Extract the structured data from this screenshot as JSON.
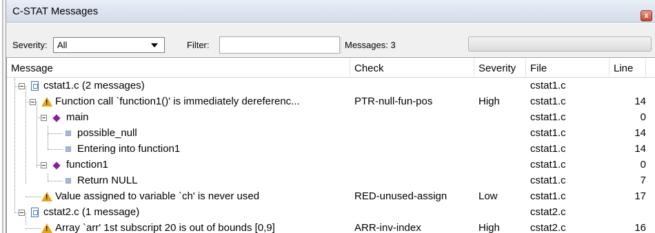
{
  "window": {
    "title": "C-STAT Messages",
    "close_glyph": "x"
  },
  "toolbar": {
    "severity_label": "Severity:",
    "severity_value": "All",
    "filter_label": "Filter:",
    "filter_value": "",
    "messages_label": "Messages: 3"
  },
  "columns": {
    "message": "Message",
    "check": "Check",
    "severity": "Severity",
    "file": "File",
    "line": "Line"
  },
  "rows": [
    {
      "message": "cstat1.c  (2 messages)",
      "check": "",
      "severity": "",
      "file": "cstat1.c",
      "line": ""
    },
    {
      "message": "Function call `function1()' is immediately dereferenc...",
      "check": "PTR-null-fun-pos",
      "severity": "High",
      "file": "cstat1.c",
      "line": "14"
    },
    {
      "message": "main",
      "check": "",
      "severity": "",
      "file": "cstat1.c",
      "line": "0"
    },
    {
      "message": "possible_null",
      "check": "",
      "severity": "",
      "file": "cstat1.c",
      "line": "14"
    },
    {
      "message": "Entering into function1",
      "check": "",
      "severity": "",
      "file": "cstat1.c",
      "line": "14"
    },
    {
      "message": "function1",
      "check": "",
      "severity": "",
      "file": "cstat1.c",
      "line": "0"
    },
    {
      "message": "Return NULL",
      "check": "",
      "severity": "",
      "file": "cstat1.c",
      "line": "7"
    },
    {
      "message": "Value assigned to variable `ch' is never used",
      "check": "RED-unused-assign",
      "severity": "Low",
      "file": "cstat1.c",
      "line": "17"
    },
    {
      "message": "cstat2.c  (1 message)",
      "check": "",
      "severity": "",
      "file": "cstat2.c",
      "line": ""
    },
    {
      "message": "Array `arr' 1st subscript 20 is out of bounds [0,9]",
      "check": "ARR-inv-index",
      "severity": "High",
      "file": "cstat2.c",
      "line": "16"
    }
  ],
  "icons": {
    "file": "file-icon",
    "warning": "warning-icon",
    "function": "function-diamond-icon",
    "step": "step-square-icon",
    "expand": "collapse-toggle-icon"
  },
  "colors": {
    "warning": "#e8a317",
    "function": "#8b1c9c",
    "step": "#a9b9d4",
    "title_bg": "#dce4f0"
  }
}
